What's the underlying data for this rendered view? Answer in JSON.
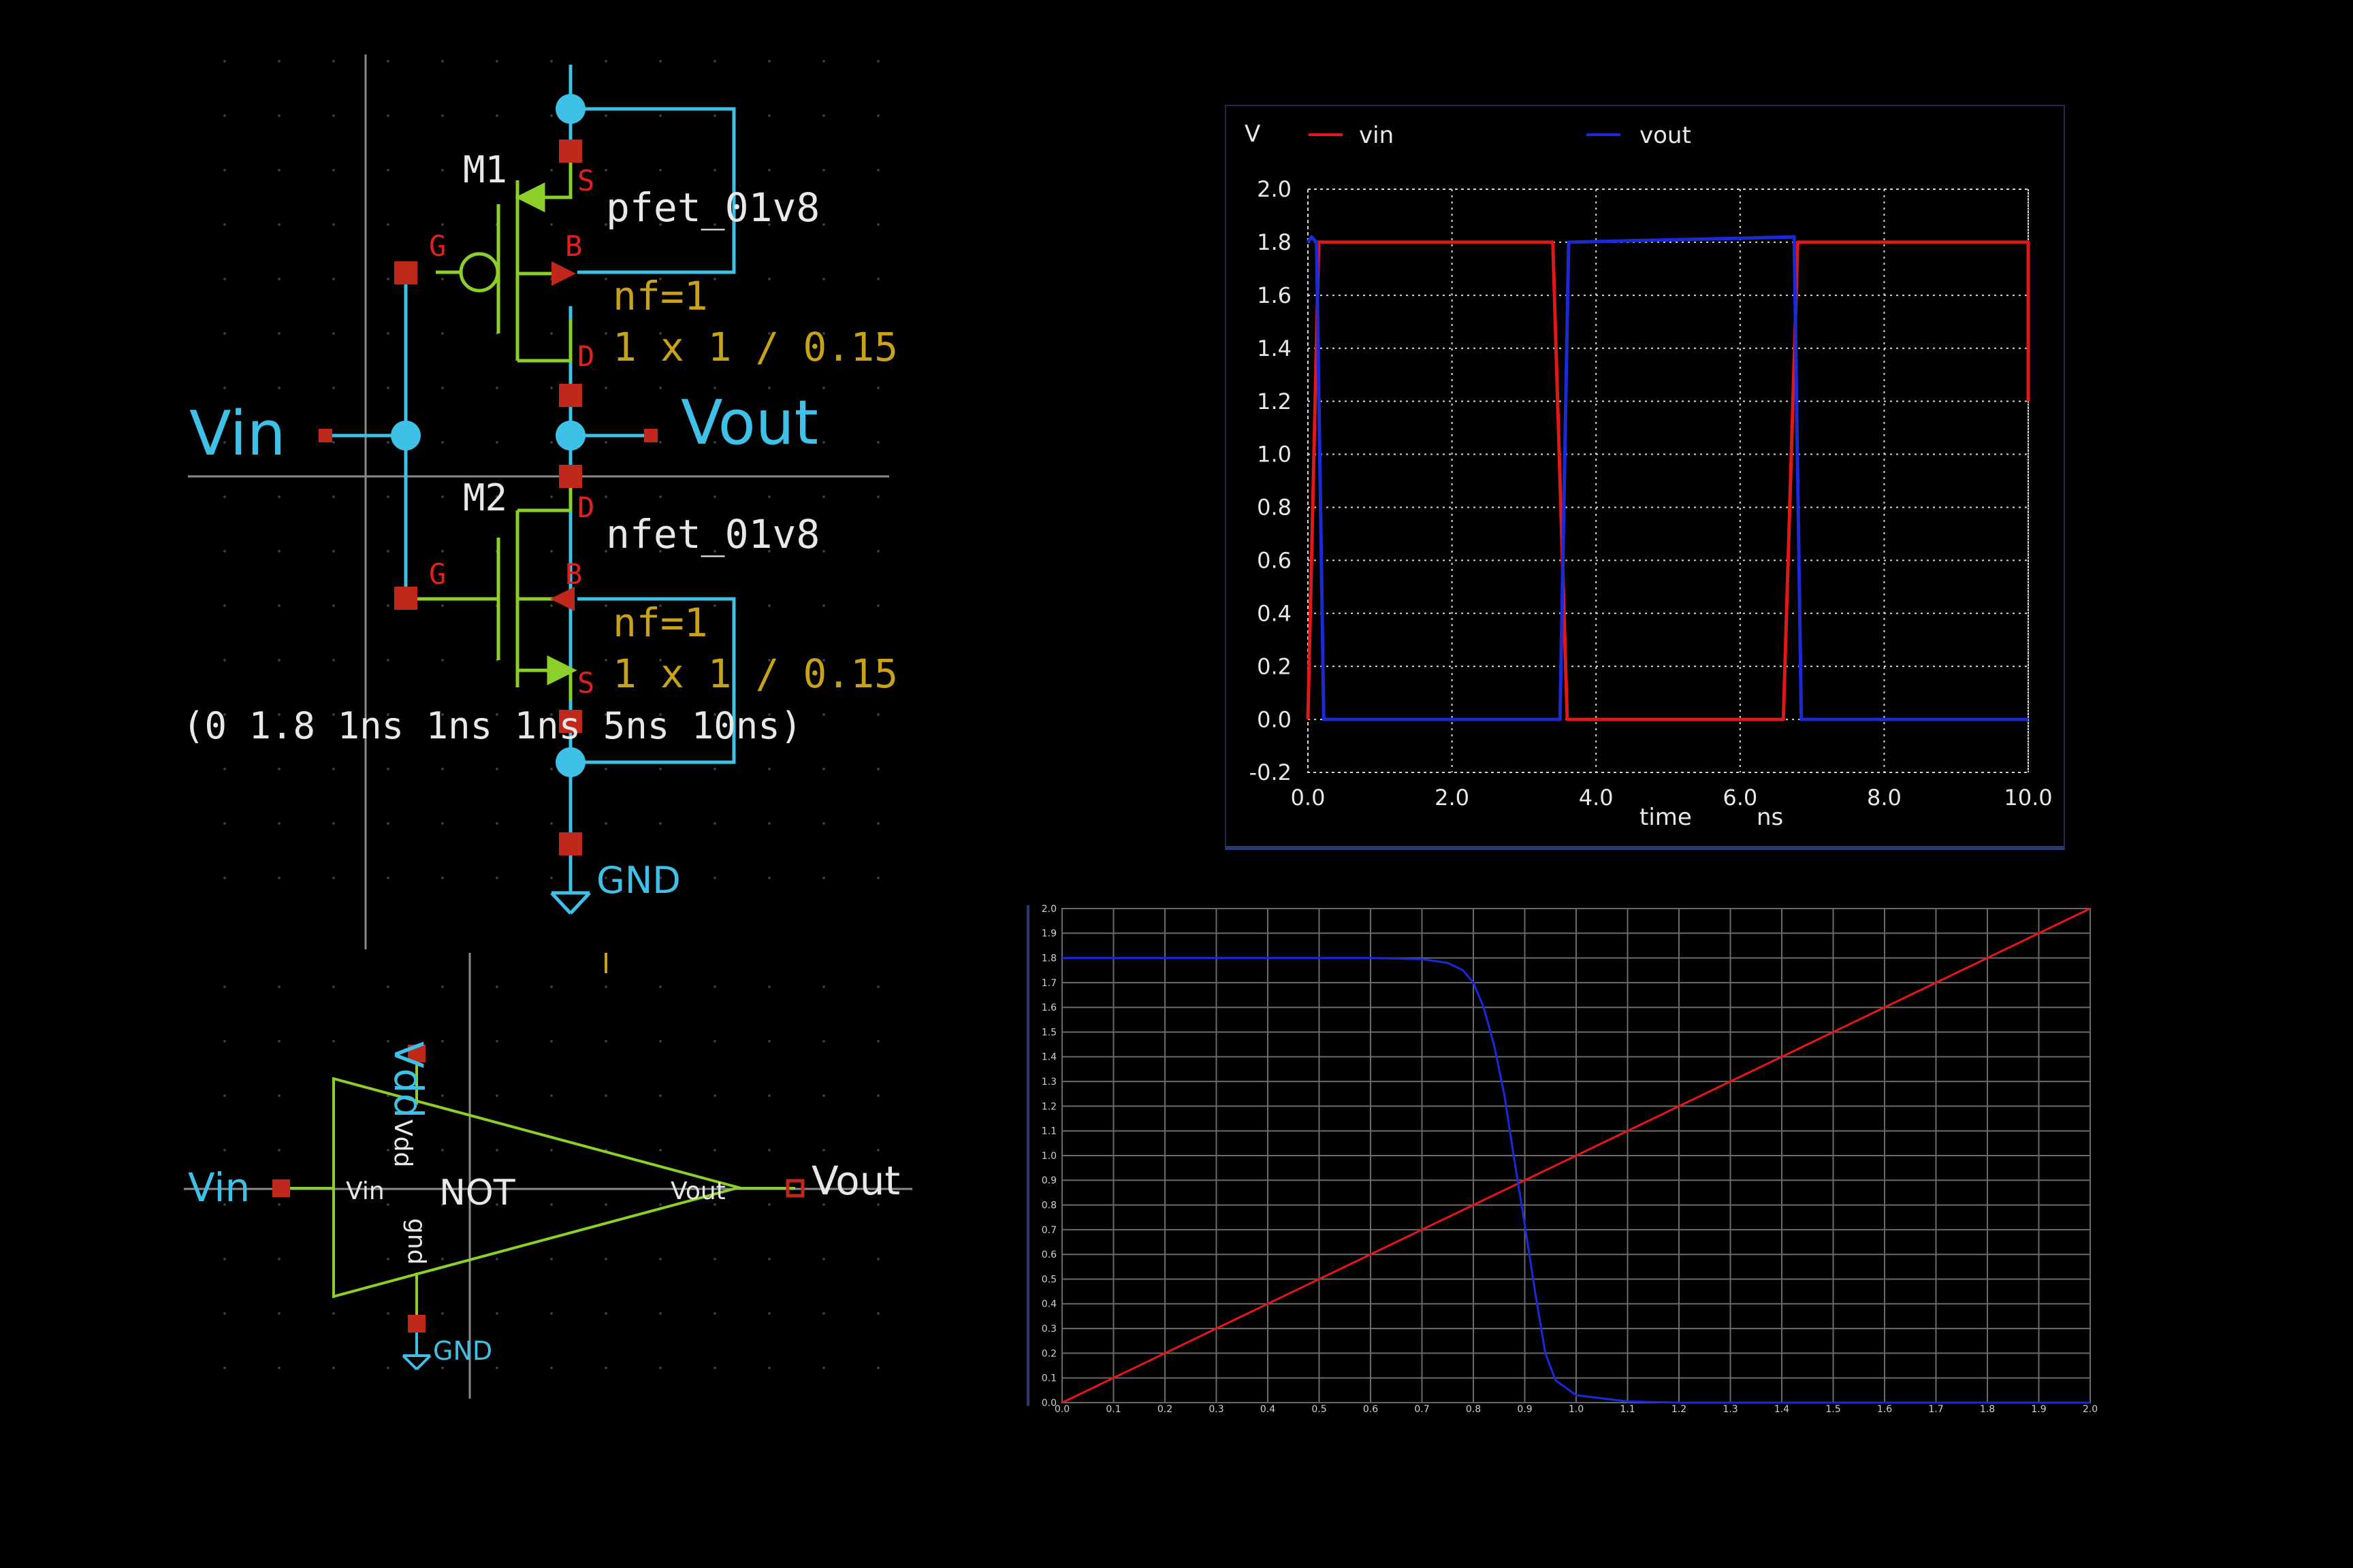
{
  "colors": {
    "background": "#000000",
    "wire": "#3fc0e6",
    "device": "#8ccf2a",
    "pin": "#c0281c",
    "pin_label": "#e02020",
    "param": "#c7a21a",
    "text": "#e8e8e8",
    "vin_trace": "#e01818",
    "vout_trace": "#1a2ad8"
  },
  "schematic": {
    "m1": {
      "name": "M1",
      "model": "pfet_01v8",
      "nf": "nf=1",
      "size": "1 x 1 / 0.15",
      "pins": {
        "s": "S",
        "g": "G",
        "b": "B",
        "d": "D"
      }
    },
    "m2": {
      "name": "M2",
      "model": "nfet_01v8",
      "nf": "nf=1",
      "size": "1 x 1 / 0.15",
      "pins": {
        "d": "D",
        "g": "G",
        "b": "B",
        "s": "S"
      }
    },
    "vin_label": "Vin",
    "vout_label": "Vout",
    "gnd_label": "GND",
    "pulse_spec": "(0 1.8 1ns 1ns 1ns 5ns 10ns)"
  },
  "symbol": {
    "name": "NOT",
    "vdd_label": "Vdd",
    "gnd_label": "GND",
    "vin_label": "Vin",
    "vout_label": "Vout",
    "pin_vin": "Vin",
    "pin_vout": "Vout",
    "pin_vdd": "Vdd",
    "pin_gnd": "gnd"
  },
  "chart_data": [
    {
      "type": "line",
      "ylabel": "V",
      "xlabel": "time",
      "xunit": "ns",
      "xlim": [
        0,
        10
      ],
      "ylim": [
        -0.2,
        2.0
      ],
      "x_ticks": [
        "0.0",
        "2.0",
        "4.0",
        "6.0",
        "8.0",
        "10.0"
      ],
      "y_ticks": [
        "-0.2",
        "0.0",
        "0.2",
        "0.4",
        "0.6",
        "0.8",
        "1.0",
        "1.2",
        "1.4",
        "1.6",
        "1.8",
        "2.0"
      ],
      "grid": true,
      "legend": "top",
      "series": [
        {
          "name": "vin",
          "color": "#e01818",
          "x": [
            0,
            0.15,
            3.4,
            3.6,
            6.6,
            6.8,
            10.0,
            10.0
          ],
          "y": [
            0,
            1.8,
            1.8,
            0,
            0,
            1.8,
            1.8,
            1.2
          ]
        },
        {
          "name": "vout",
          "color": "#1a2ad8",
          "x": [
            0,
            0.05,
            0.12,
            0.22,
            3.5,
            3.62,
            6.75,
            6.85,
            10.0
          ],
          "y": [
            1.8,
            1.82,
            1.8,
            0,
            0,
            1.8,
            1.82,
            0,
            0
          ]
        }
      ]
    },
    {
      "type": "line",
      "xlim": [
        0,
        2.0
      ],
      "ylim": [
        0,
        2.0
      ],
      "x_ticks": [
        "0.0",
        "0.1",
        "0.2",
        "0.3",
        "0.4",
        "0.5",
        "0.6",
        "0.7",
        "0.8",
        "0.9",
        "1.0",
        "1.1",
        "1.2",
        "1.3",
        "1.4",
        "1.5",
        "1.6",
        "1.7",
        "1.8",
        "1.9",
        "2.0"
      ],
      "y_ticks": [
        "0.0",
        "0.1",
        "0.2",
        "0.3",
        "0.4",
        "0.5",
        "0.6",
        "0.7",
        "0.8",
        "0.9",
        "1.0",
        "1.1",
        "1.2",
        "1.3",
        "1.4",
        "1.5",
        "1.6",
        "1.7",
        "1.8",
        "1.9",
        "2.0"
      ],
      "grid": true,
      "series": [
        {
          "color": "#e01818",
          "x": [
            0,
            2.0
          ],
          "y": [
            0,
            2.0
          ]
        },
        {
          "color": "#1a2ad8",
          "x": [
            0,
            0.6,
            0.7,
            0.75,
            0.78,
            0.8,
            0.82,
            0.84,
            0.86,
            0.88,
            0.9,
            0.92,
            0.94,
            0.96,
            1.0,
            1.1,
            1.2,
            2.0
          ],
          "y": [
            1.8,
            1.8,
            1.795,
            1.78,
            1.75,
            1.7,
            1.6,
            1.45,
            1.25,
            0.98,
            0.72,
            0.45,
            0.2,
            0.09,
            0.03,
            0.005,
            0,
            0
          ]
        }
      ]
    }
  ]
}
